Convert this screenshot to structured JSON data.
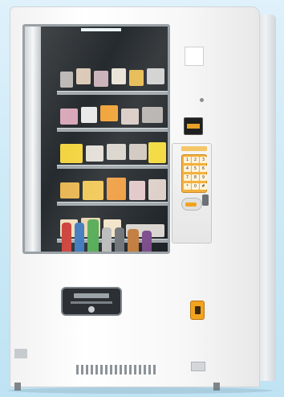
{
  "scene": {
    "subject": "vending machine",
    "colors": {
      "background": "#cfe9f7",
      "body": "#f5f5f5",
      "keypad": "#f4b13d",
      "coin_slot": "#f2a41f",
      "window_interior": "#1d2226"
    },
    "keypad_keys": [
      "1",
      "2",
      "3",
      "4",
      "5",
      "6",
      "7",
      "8",
      "9",
      "*",
      "0",
      "#"
    ]
  }
}
